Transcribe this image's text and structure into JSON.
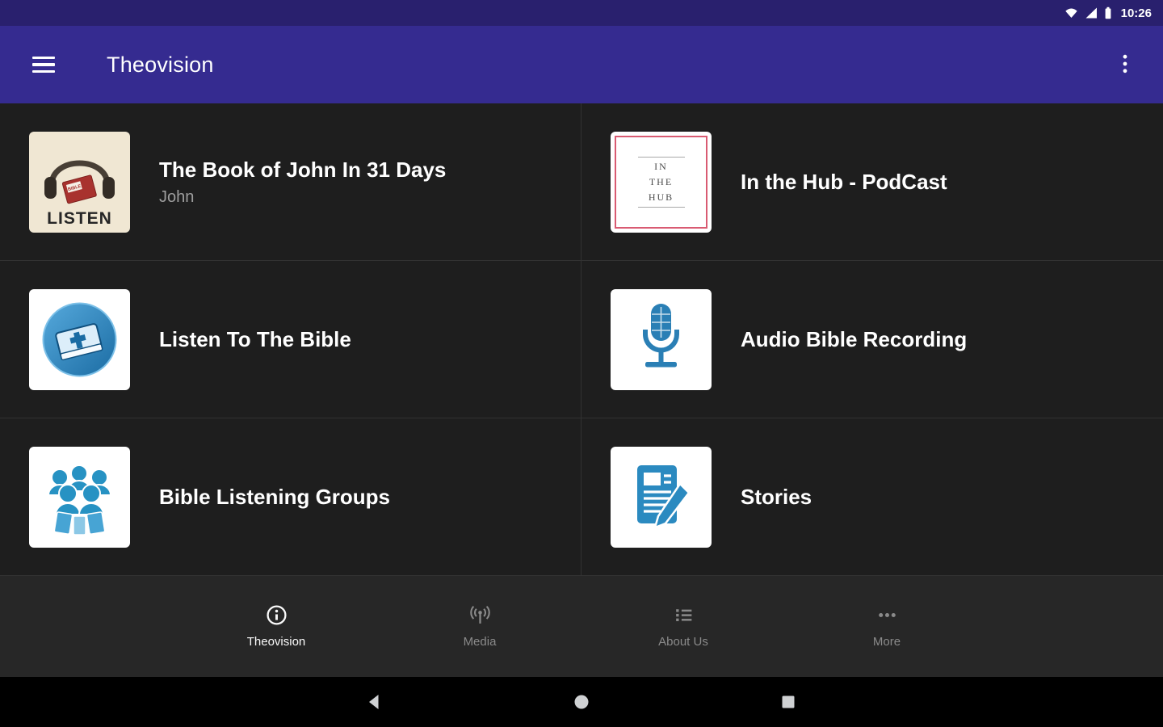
{
  "colors": {
    "status_bar": "#29206e",
    "app_bar": "#352b90",
    "content_bg": "#1e1e1e",
    "bottom_nav_bg": "#272727",
    "system_nav_bg": "#000000",
    "divider": "#323232",
    "accent_blue": "#2b8ac0",
    "title_text": "#ffffff",
    "subtitle_text": "#9e9e9e",
    "nav_inactive": "#8a8a8a",
    "nav_active": "#fafafa"
  },
  "status_bar": {
    "time": "10:26",
    "icons": [
      "wifi-icon",
      "cell-signal-icon",
      "battery-icon"
    ]
  },
  "app_bar": {
    "title": "Theovision",
    "menu_icon": "hamburger-menu-icon",
    "overflow_icon": "overflow-menu-icon"
  },
  "grid": {
    "items": [
      {
        "title": "The Book of John In 31 Days",
        "subtitle": "John",
        "icon": "john-album-art",
        "icon_text": "LISTEN",
        "icon_badge": "BIBLE"
      },
      {
        "title": "In the Hub - PodCast",
        "icon": "in-the-hub-art",
        "icon_lines": [
          "IN",
          "THE",
          "HUB"
        ]
      },
      {
        "title": "Listen To The Bible",
        "icon": "bible-circle-icon"
      },
      {
        "title": "Audio Bible Recording",
        "icon": "microphone-icon"
      },
      {
        "title": "Bible Listening Groups",
        "icon": "people-group-icon"
      },
      {
        "title": "Stories",
        "icon": "document-pen-icon"
      }
    ]
  },
  "bottom_nav": {
    "items": [
      {
        "label": "Theovision",
        "icon": "info-icon",
        "active": true
      },
      {
        "label": "Media",
        "icon": "broadcast-icon",
        "active": false
      },
      {
        "label": "About Us",
        "icon": "list-icon",
        "active": false
      },
      {
        "label": "More",
        "icon": "more-horizontal-icon",
        "active": false
      }
    ]
  },
  "system_nav": {
    "buttons": [
      "back",
      "home",
      "recents"
    ]
  }
}
